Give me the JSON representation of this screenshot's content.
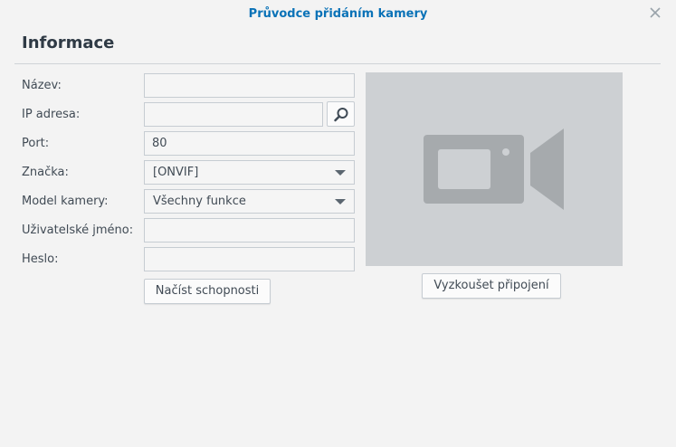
{
  "dialog": {
    "title": "Průvodce přidáním kamery",
    "close_icon": "close-icon"
  },
  "section": {
    "title": "Informace"
  },
  "form": {
    "name_label": "Název:",
    "name_value": "",
    "ip_label": "IP adresa:",
    "ip_value": "",
    "port_label": "Port:",
    "port_value": "80",
    "brand_label": "Značka:",
    "brand_value": "[ONVIF]",
    "model_label": "Model kamery:",
    "model_value": "Všechny funkce",
    "username_label": "Uživatelské jméno:",
    "username_value": "",
    "password_label": "Heslo:",
    "password_value": ""
  },
  "buttons": {
    "load_capabilities": "Načíst schopnosti",
    "test_connection": "Vyzkoušet připojení"
  },
  "icons": {
    "search": "search-icon",
    "camera_placeholder": "video-camera-icon",
    "dropdown": "chevron-down-icon"
  },
  "colors": {
    "title": "#0a72b7",
    "preview_background": "#cdd0d3",
    "camera_icon": "#a6aaad"
  }
}
